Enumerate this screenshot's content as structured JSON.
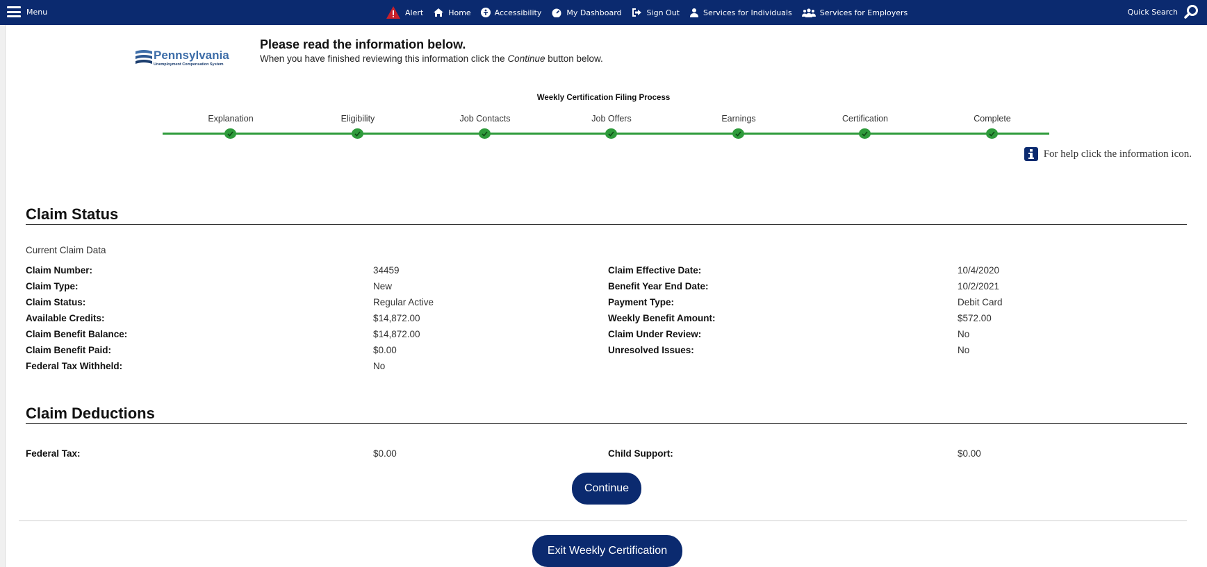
{
  "nav": {
    "menu_label": "Menu",
    "items": [
      {
        "label": "Alert",
        "icon": "alert-icon"
      },
      {
        "label": "Home",
        "icon": "home-icon"
      },
      {
        "label": "Accessibility",
        "icon": "accessibility-icon"
      },
      {
        "label": "My Dashboard",
        "icon": "dashboard-icon"
      },
      {
        "label": "Sign Out",
        "icon": "sign-out-icon"
      },
      {
        "label": "Services for Individuals",
        "icon": "person-icon"
      },
      {
        "label": "Services for Employers",
        "icon": "group-icon"
      }
    ],
    "quick_search_label": "Quick Search"
  },
  "logo": {
    "name": "Pennsylvania",
    "subtitle": "Unemployment Compensation System"
  },
  "intro": {
    "title": "Please read the information below.",
    "text_before": "When you have finished reviewing this information click the ",
    "text_emphasis": "Continue",
    "text_after": " button below."
  },
  "process": {
    "title": "Weekly Certification Filing Process",
    "steps": [
      "Explanation",
      "Eligibility",
      "Job Contacts",
      "Job Offers",
      "Earnings",
      "Certification",
      "Complete"
    ]
  },
  "help_text": "For help click the information icon.",
  "claim_status": {
    "title": "Claim Status",
    "subtitle": "Current Claim Data",
    "rows": [
      {
        "l1": "Claim Number:",
        "v1": "34459",
        "l2": "Claim Effective Date:",
        "v2": "10/4/2020"
      },
      {
        "l1": "Claim Type:",
        "v1": "New",
        "l2": "Benefit Year End Date:",
        "v2": "10/2/2021"
      },
      {
        "l1": "Claim Status:",
        "v1": "Regular Active",
        "l2": "Payment Type:",
        "v2": "Debit Card"
      },
      {
        "l1": "Available Credits:",
        "v1": "$14,872.00",
        "l2": "Weekly Benefit Amount:",
        "v2": "$572.00"
      },
      {
        "l1": "Claim Benefit Balance:",
        "v1": "$14,872.00",
        "l2": "Claim Under Review:",
        "v2": "No"
      },
      {
        "l1": "Claim Benefit Paid:",
        "v1": "$0.00",
        "l2": "Unresolved Issues:",
        "v2": "No"
      },
      {
        "l1": "Federal Tax Withheld:",
        "v1": "No",
        "l2": "",
        "v2": ""
      }
    ]
  },
  "claim_deductions": {
    "title": "Claim Deductions",
    "rows": [
      {
        "l1": "Federal Tax:",
        "v1": "$0.00",
        "l2": "Child Support:",
        "v2": "$0.00"
      }
    ]
  },
  "buttons": {
    "continue": "Continue",
    "exit": "Exit Weekly Certification"
  },
  "colors": {
    "navy": "#0b2a6f",
    "progress_green": "#2e9b3b",
    "alert_red": "#c8202b"
  }
}
